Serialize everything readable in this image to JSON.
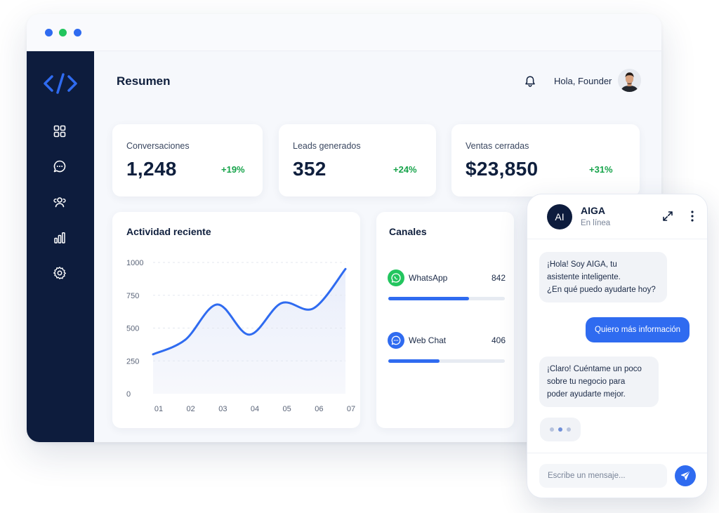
{
  "header": {
    "title": "Resumen",
    "greeting": "Hola, Founder"
  },
  "sidebar": {
    "items": [
      {
        "icon": "grid-icon"
      },
      {
        "icon": "chat-icon"
      },
      {
        "icon": "users-icon"
      },
      {
        "icon": "bar-chart-icon"
      },
      {
        "icon": "gear-icon"
      }
    ]
  },
  "stats": [
    {
      "label": "Conversaciones",
      "value": "1,248",
      "delta": "+19%"
    },
    {
      "label": "Leads generados",
      "value": "352",
      "delta": "+24%"
    },
    {
      "label": "Ventas cerradas",
      "value": "$23,850",
      "delta": "+31%"
    }
  ],
  "activity": {
    "title": "Actividad reciente"
  },
  "channels": {
    "title": "Canales",
    "items": [
      {
        "name": "WhatsApp",
        "count": "842",
        "fraction": 0.69
      },
      {
        "name": "Web Chat",
        "count": "406",
        "fraction": 0.44
      }
    ]
  },
  "chat": {
    "avatar_text": "AI",
    "name": "AIGA",
    "status": "En línea",
    "messages": [
      {
        "from": "bot",
        "lines": [
          "¡Hola! Soy AIGA, tu",
          "asistente inteligente.",
          "¿En qué puedo ayudarte hoy?"
        ]
      },
      {
        "from": "user",
        "lines": [
          "Quiero más información"
        ]
      },
      {
        "from": "bot",
        "lines": [
          "¡Claro! Cuéntame un poco",
          "sobre tu negocio para",
          "poder ayudarte mejor."
        ]
      }
    ],
    "input_placeholder": "Escribe un mensaje..."
  },
  "colors": {
    "accent": "#2f6bf0",
    "sidebar": "#0d1c3d",
    "positive": "#16a34a",
    "whatsapp": "#22c55e"
  },
  "chart_data": {
    "type": "area",
    "title": "Actividad reciente",
    "xlabel": "",
    "ylabel": "",
    "x": [
      "01",
      "02",
      "03",
      "04",
      "05",
      "06",
      "07"
    ],
    "y_ticks": [
      0,
      250,
      500,
      750,
      1000
    ],
    "ylim": [
      0,
      1000
    ],
    "series": [
      {
        "values": [
          300,
          410,
          680,
          450,
          690,
          650,
          950
        ]
      }
    ],
    "grid": true
  }
}
